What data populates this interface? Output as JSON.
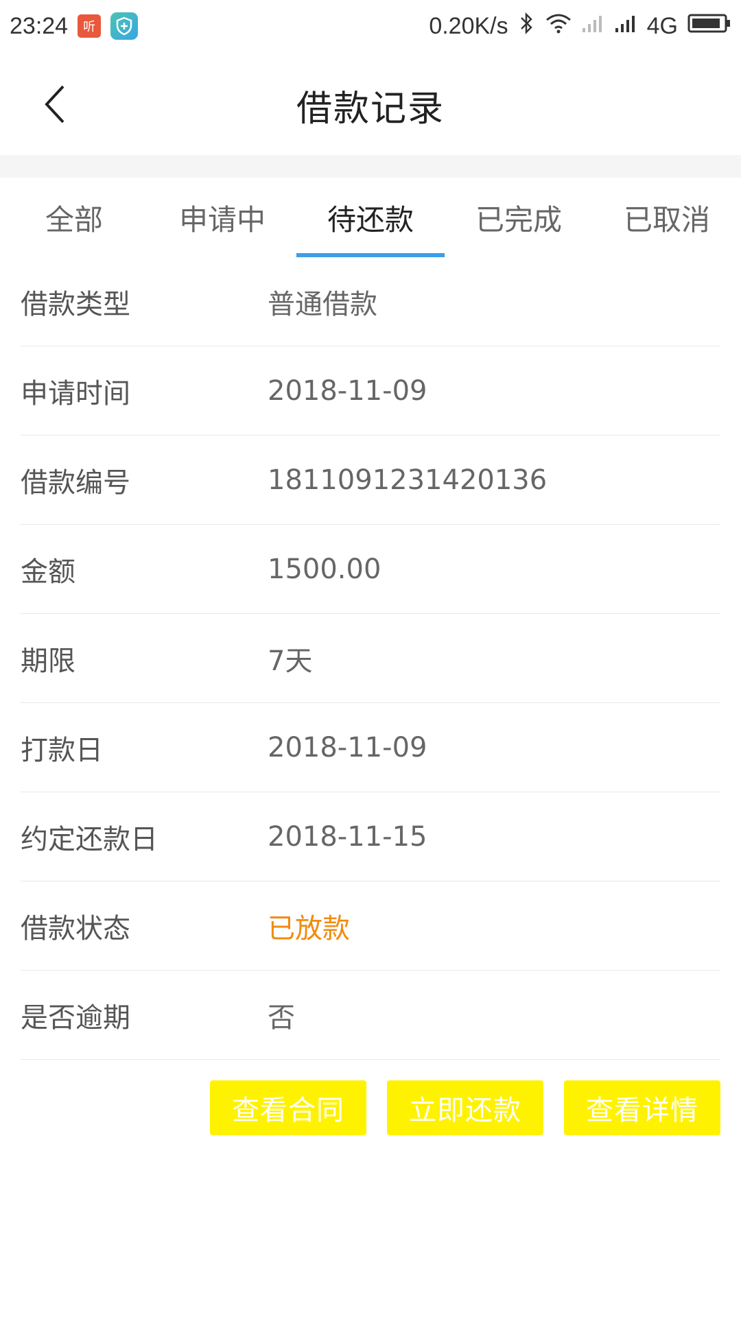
{
  "status_bar": {
    "time": "23:24",
    "ting_icon_text": "听",
    "net_speed": "0.20K/s",
    "network_type": "4G"
  },
  "header": {
    "title": "借款记录"
  },
  "tabs": [
    {
      "label": "全部",
      "active": false
    },
    {
      "label": "申请中",
      "active": false
    },
    {
      "label": "待还款",
      "active": true
    },
    {
      "label": "已完成",
      "active": false
    },
    {
      "label": "已取消",
      "active": false
    }
  ],
  "details": [
    {
      "label": "借款类型",
      "value": "普通借款"
    },
    {
      "label": "申请时间",
      "value": "2018-11-09"
    },
    {
      "label": "借款编号",
      "value": "1811091231420136"
    },
    {
      "label": "金额",
      "value": "1500.00"
    },
    {
      "label": "期限",
      "value": "7天"
    },
    {
      "label": "打款日",
      "value": "2018-11-09"
    },
    {
      "label": "约定还款日",
      "value": "2018-11-15"
    },
    {
      "label": "借款状态",
      "value": "已放款"
    },
    {
      "label": "是否逾期",
      "value": "否"
    }
  ],
  "actions": {
    "view_contract": "查看合同",
    "repay_now": "立即还款",
    "view_details": "查看详情"
  },
  "colors": {
    "tab_indicator": "#3d9ee8",
    "status_orange": "#f08b10",
    "button_yellow": "#fff200"
  }
}
